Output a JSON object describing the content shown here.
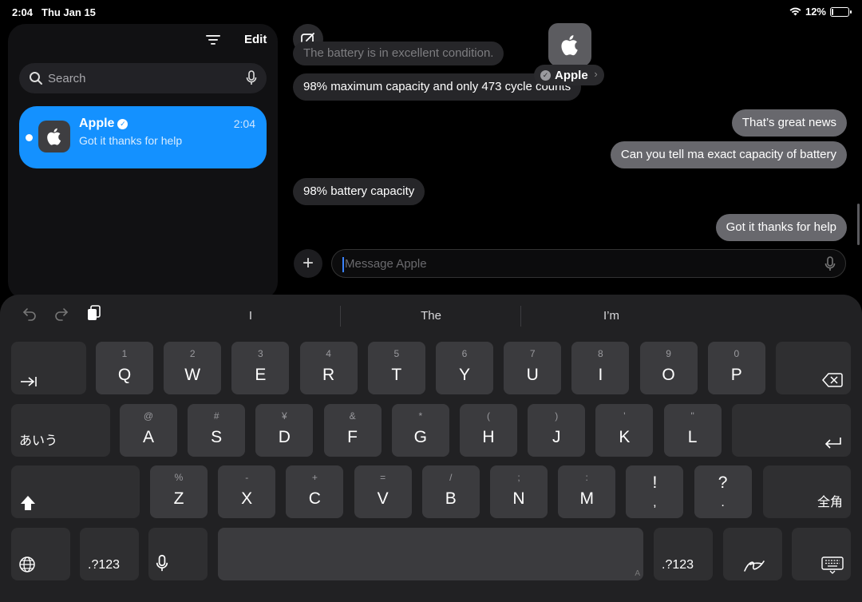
{
  "status_bar": {
    "time": "2:04",
    "date": "Thu Jan 15",
    "battery": "12%",
    "battery_level": 0.12
  },
  "sidebar": {
    "edit_label": "Edit",
    "search_placeholder": "Search",
    "conversation": {
      "name": "Apple",
      "time": "2:04",
      "preview": "Got it thanks for help",
      "avatar_icon": "apple-logo-icon"
    }
  },
  "chat": {
    "contact_name": "Apple",
    "messages": [
      {
        "dir": "in",
        "text": "The battery is in excellent condition."
      },
      {
        "dir": "in",
        "text": "98% maximum capacity and only 473 cycle counts"
      },
      {
        "dir": "out",
        "text": "That’s great news"
      },
      {
        "dir": "out",
        "text": "Can you tell ma exact capacity of battery"
      },
      {
        "dir": "in",
        "text": "98% battery capacity"
      },
      {
        "dir": "out",
        "text": "Got it thanks for help"
      }
    ],
    "input_placeholder": "Message Apple"
  },
  "keyboard": {
    "suggestions": [
      "I",
      "The",
      "I’m"
    ],
    "row1": [
      {
        "main": "Q",
        "sub": "1"
      },
      {
        "main": "W",
        "sub": "2"
      },
      {
        "main": "E",
        "sub": "3"
      },
      {
        "main": "R",
        "sub": "4"
      },
      {
        "main": "T",
        "sub": "5"
      },
      {
        "main": "Y",
        "sub": "6"
      },
      {
        "main": "U",
        "sub": "7"
      },
      {
        "main": "I",
        "sub": "8"
      },
      {
        "main": "O",
        "sub": "9"
      },
      {
        "main": "P",
        "sub": "0"
      }
    ],
    "row2": [
      {
        "main": "A",
        "sub": "@"
      },
      {
        "main": "S",
        "sub": "#"
      },
      {
        "main": "D",
        "sub": "¥"
      },
      {
        "main": "F",
        "sub": "&"
      },
      {
        "main": "G",
        "sub": "*"
      },
      {
        "main": "H",
        "sub": "("
      },
      {
        "main": "J",
        "sub": ")"
      },
      {
        "main": "K",
        "sub": "'"
      },
      {
        "main": "L",
        "sub": "\""
      }
    ],
    "row3": [
      {
        "main": "Z",
        "sub": "%"
      },
      {
        "main": "X",
        "sub": "-"
      },
      {
        "main": "C",
        "sub": "+"
      },
      {
        "main": "V",
        "sub": "="
      },
      {
        "main": "B",
        "sub": "/"
      },
      {
        "main": "N",
        "sub": ";"
      },
      {
        "main": "M",
        "sub": ":"
      },
      {
        "main": ",",
        "sub": "!"
      },
      {
        "main": ".",
        "sub": "?"
      }
    ],
    "kana_label": "あいう",
    "zenkaku_label": "全角",
    "numbers_label": ".?123",
    "space_hint": "A"
  }
}
